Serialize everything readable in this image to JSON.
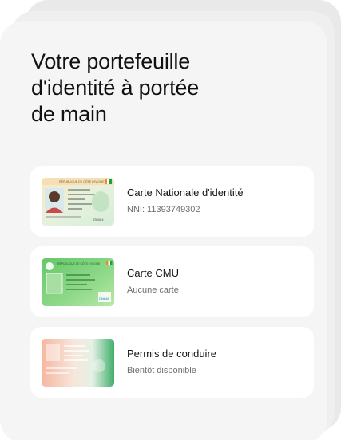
{
  "title": {
    "line1": "Votre portefeuille",
    "line2": "d'identité à portée",
    "line3": "de main"
  },
  "documents": [
    {
      "name": "Carte Nationale d'identité",
      "subtitle": "NNI: 11393749302",
      "icon": "national-id-card-icon",
      "card_header": "RÉPUBLIQUE DE CÔTE D'IVOIRE",
      "card_code": "T50064"
    },
    {
      "name": "Carte CMU",
      "subtitle": "Aucune carte",
      "icon": "cmu-card-icon",
      "card_header": "RÉPUBLIQUE DE CÔTE D'IVOIRE",
      "card_logo": "CNAM"
    },
    {
      "name": "Permis de conduire",
      "subtitle": "Bientôt disponible",
      "icon": "driving-license-icon"
    }
  ],
  "colors": {
    "background": "#ffffff",
    "panel": "#f5f5f5",
    "card": "#ffffff",
    "title_text": "#111111",
    "subtitle_text": "#6e6e6e",
    "ivory_orange": "#f18a1c",
    "ivory_green": "#1e9e4a",
    "cmu_green": "#5cc15e"
  }
}
